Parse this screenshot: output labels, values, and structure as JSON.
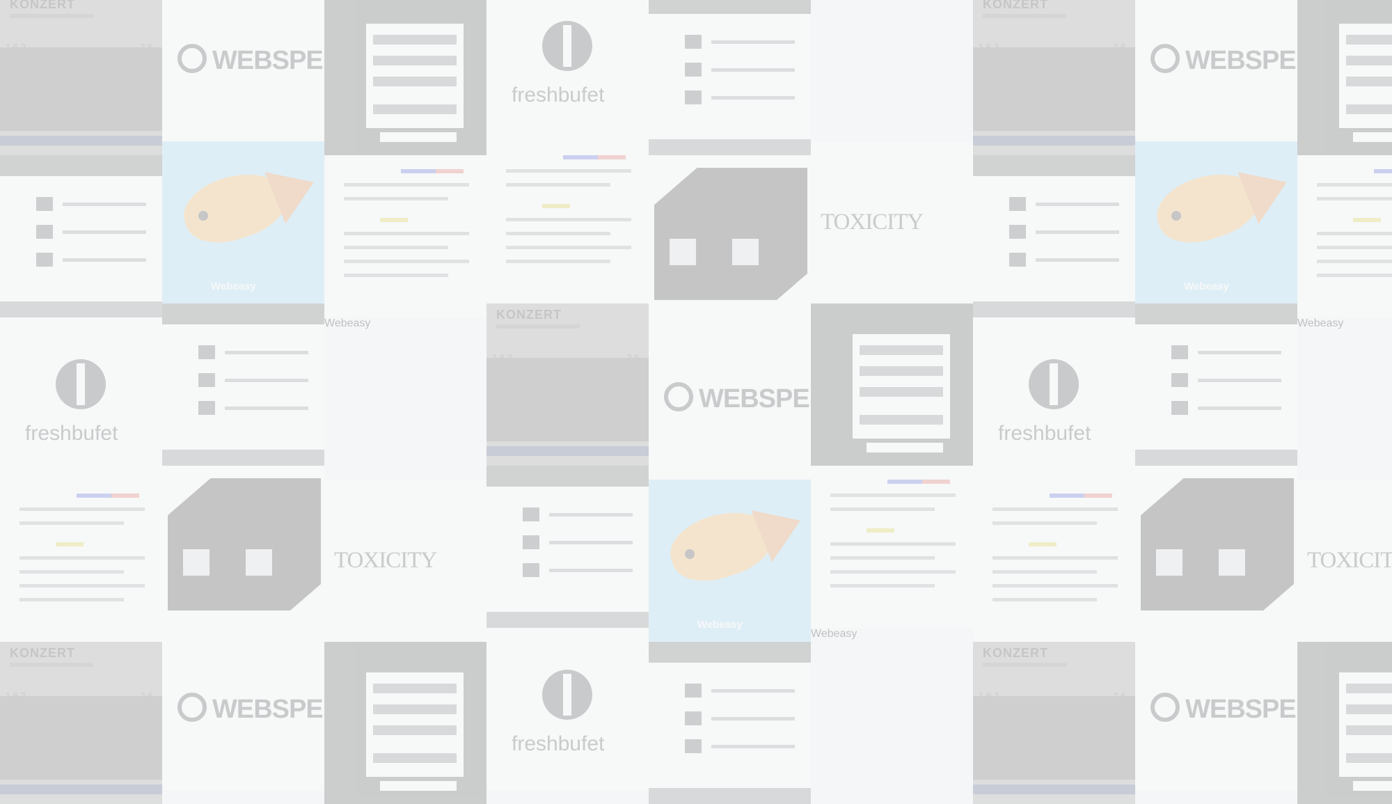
{
  "tiles": {
    "konzert_title": "KONZERT",
    "konzert_left": "1.6.2",
    "konzert_right": "2.6.",
    "webspell": "WEBSPELL",
    "freshbufet_logo": "freshbufet",
    "webeasy": "Webeasy",
    "toxicity": "TOXICITY",
    "fish_caption": "Webeasy"
  },
  "colors": {
    "background": "#f5f6f7",
    "webeasy_blue": "#2aa7d6",
    "fish_orange": "#f2a640",
    "dark": "#1e1e1e"
  }
}
